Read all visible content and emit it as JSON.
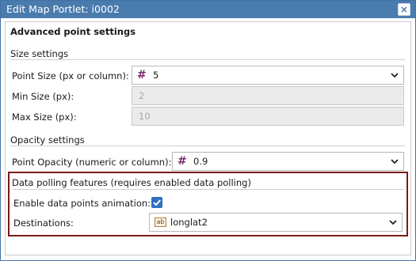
{
  "window": {
    "title": "Edit Map Portlet: i0002",
    "close_glyph": "×"
  },
  "heading": "Advanced point settings",
  "size_settings": {
    "title": "Size settings",
    "point_size": {
      "label": "Point Size (px or column):",
      "value": "5",
      "icon": "hash-icon"
    },
    "min_size": {
      "label": "Min Size (px):",
      "value": "2"
    },
    "max_size": {
      "label": "Max Size (px):",
      "value": "10"
    }
  },
  "opacity_settings": {
    "title": "Opacity settings",
    "point_opacity": {
      "label": "Point Opacity (numeric or column):",
      "value": "0.9",
      "icon": "hash-icon"
    }
  },
  "data_polling": {
    "title": "Data polling features (requires enabled data polling)",
    "animation": {
      "label": "Enable data points animation:",
      "checked": true
    },
    "destinations": {
      "label": "Destinations:",
      "value": "longlat2",
      "icon": "ab",
      "icon_name": "text-column-icon"
    }
  },
  "colors": {
    "titlebar": "#4a7bad",
    "accent": "#2f6fc5",
    "highlight_border": "#7a1a1a",
    "hash_icon": "#7a2a6f"
  }
}
